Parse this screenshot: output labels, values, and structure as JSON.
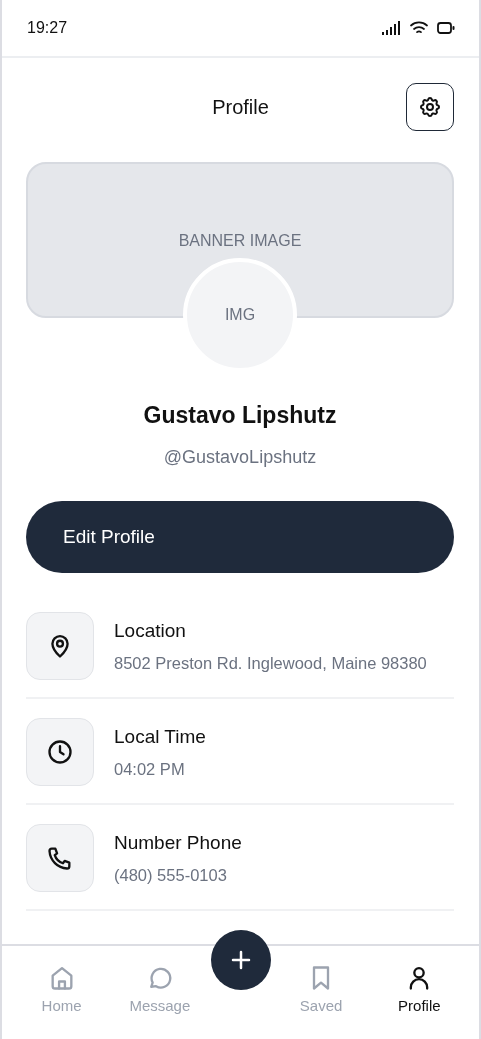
{
  "status_bar": {
    "time": "19:27"
  },
  "header": {
    "title": "Profile"
  },
  "banner": {
    "label": "BANNER IMAGE"
  },
  "avatar": {
    "label": "IMG"
  },
  "profile": {
    "name": "Gustavo Lipshutz",
    "handle": "@GustavoLipshutz"
  },
  "edit_button": {
    "label": "Edit Profile"
  },
  "info_rows": [
    {
      "kind": "location",
      "label": "Location",
      "value": "8502 Preston Rd. Inglewood, Maine 98380"
    },
    {
      "kind": "time",
      "label": "Local Time",
      "value": "04:02 PM"
    },
    {
      "kind": "phone",
      "label": "Number Phone",
      "value": "(480) 555-0103"
    }
  ],
  "nav": {
    "items": [
      {
        "kind": "home",
        "label": "Home",
        "selected": false
      },
      {
        "kind": "message",
        "label": "Message",
        "selected": false
      },
      {
        "kind": "saved",
        "label": "Saved",
        "selected": false
      },
      {
        "kind": "profile",
        "label": "Profile",
        "selected": true
      }
    ]
  }
}
